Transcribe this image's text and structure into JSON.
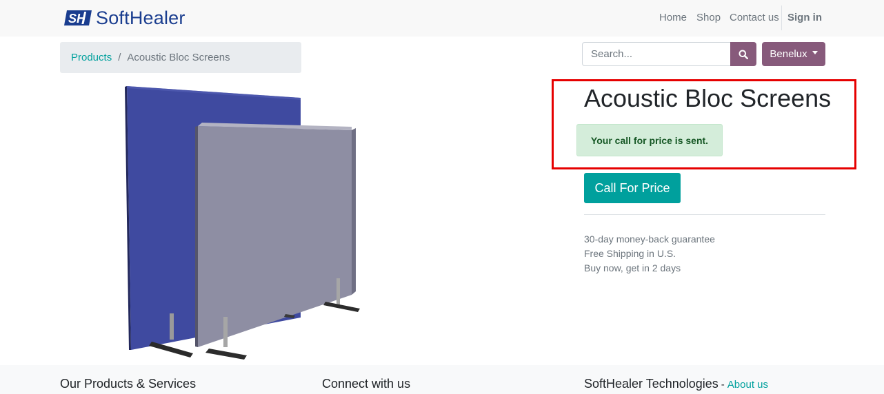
{
  "brand": {
    "name": "SoftHealer",
    "colors": {
      "brand": "#1a3d8f",
      "primary": "#875a7b",
      "accent": "#00a09d",
      "alert_bg": "#d4edda",
      "alert_text": "#155724",
      "highlight": "#e60000"
    }
  },
  "nav": {
    "home": "Home",
    "shop": "Shop",
    "contact": "Contact us",
    "signin": "Sign in"
  },
  "breadcrumb": {
    "root": "Products",
    "separator": "/",
    "current": "Acoustic Bloc Screens"
  },
  "search": {
    "placeholder": "Search...",
    "icon": "search-icon"
  },
  "pricelist": {
    "label": "Benelux"
  },
  "product": {
    "title": "Acoustic Bloc Screens",
    "alert": "Your call for price is sent.",
    "call_button": "Call For Price",
    "terms": [
      "30-day money-back guarantee",
      "Free Shipping in U.S.",
      "Buy now, get in 2 days"
    ]
  },
  "footer": {
    "col1": "Our Products & Services",
    "col2": "Connect with us",
    "col3_title": "SoftHealer Technologies",
    "col3_sep": "-",
    "col3_link": "About us"
  }
}
